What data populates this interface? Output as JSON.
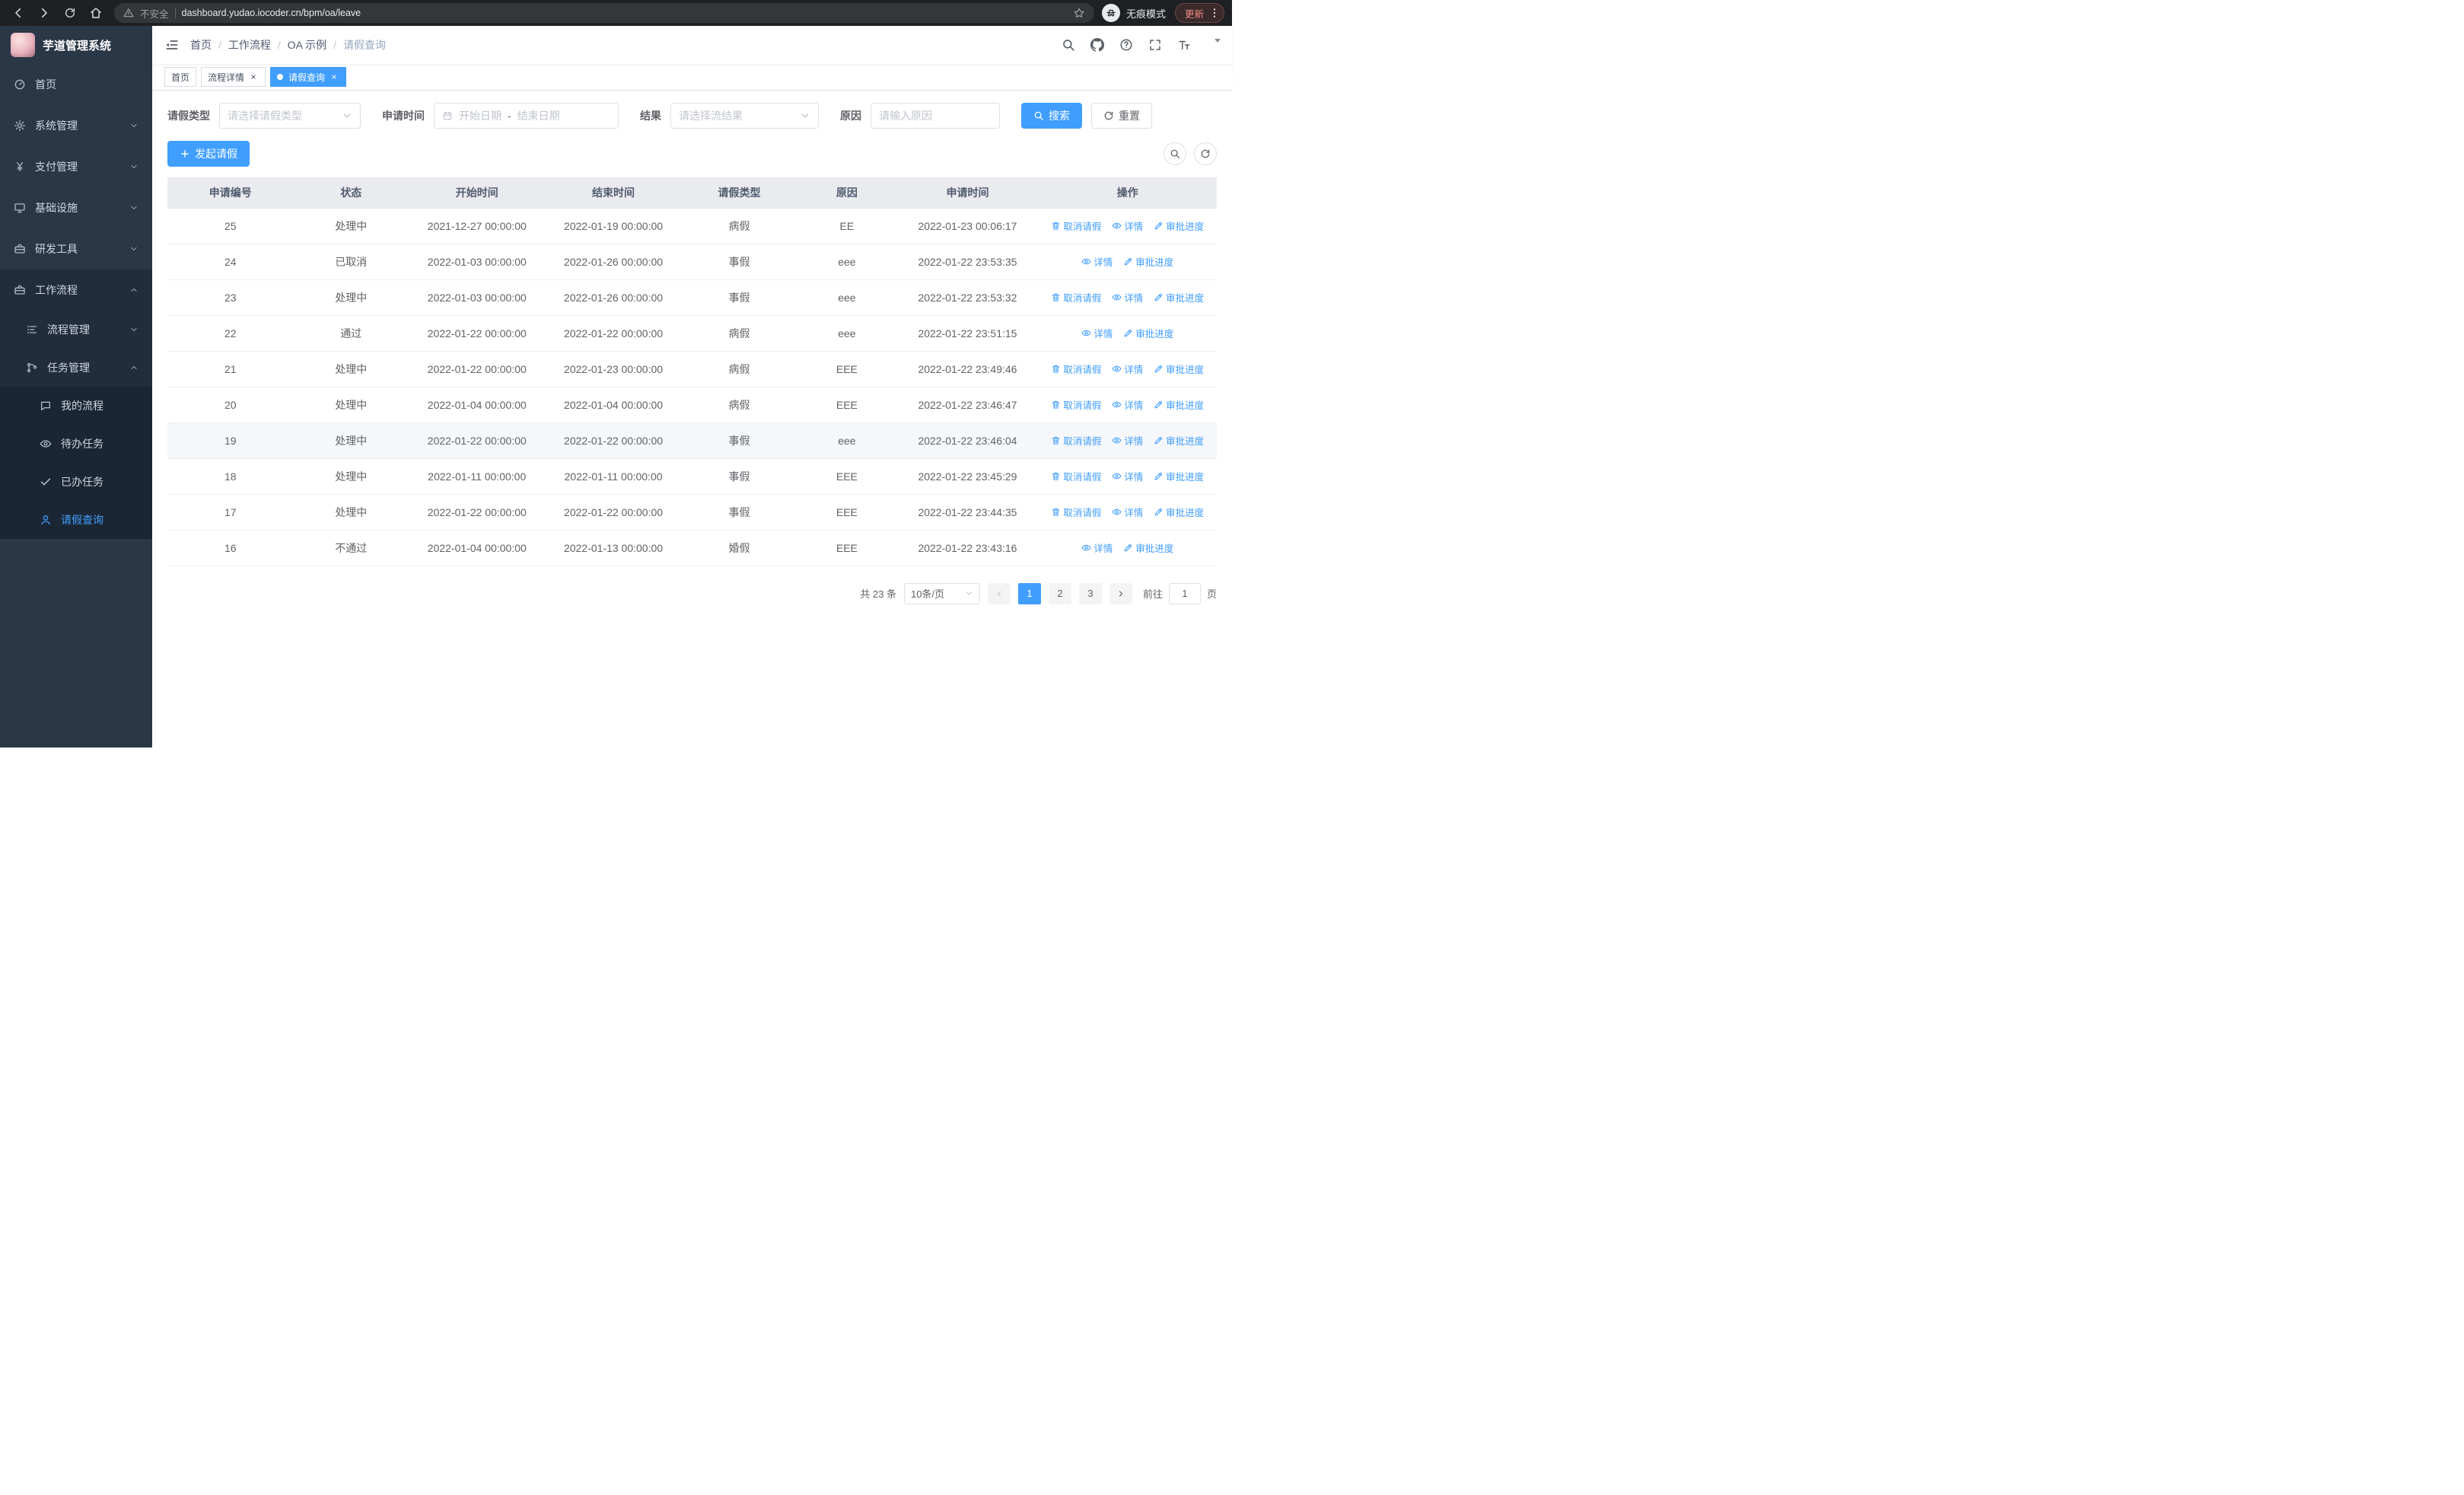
{
  "browser": {
    "security_label": "不安全",
    "url": "dashboard.yudao.iocoder.cn/bpm/oa/leave",
    "incognito_label": "无痕模式",
    "update_label": "更新"
  },
  "sidebar": {
    "logo_title": "芋道管理系统",
    "items": [
      {
        "label": "首页"
      },
      {
        "label": "系统管理"
      },
      {
        "label": "支付管理"
      },
      {
        "label": "基础设施"
      },
      {
        "label": "研发工具"
      },
      {
        "label": "工作流程"
      }
    ],
    "workflow_children": [
      {
        "label": "流程管理"
      },
      {
        "label": "任务管理"
      }
    ],
    "task_children": [
      {
        "label": "我的流程"
      },
      {
        "label": "待办任务"
      },
      {
        "label": "已办任务"
      },
      {
        "label": "请假查询"
      }
    ]
  },
  "header": {
    "breadcrumb": [
      "首页",
      "工作流程",
      "OA 示例",
      "请假查询"
    ],
    "separator": "/"
  },
  "tabs": [
    {
      "label": "首页"
    },
    {
      "label": "流程详情"
    },
    {
      "label": "请假查询"
    }
  ],
  "filters": {
    "leave_type_label": "请假类型",
    "leave_type_placeholder": "请选择请假类型",
    "apply_time_label": "申请时间",
    "start_date_placeholder": "开始日期",
    "date_separator": "-",
    "end_date_placeholder": "结束日期",
    "result_label": "结果",
    "result_placeholder": "请选择流结果",
    "reason_label": "原因",
    "reason_placeholder": "请输入原因",
    "search_label": "搜索",
    "reset_label": "重置"
  },
  "toolbar": {
    "create_label": "发起请假"
  },
  "table": {
    "headers": [
      "申请编号",
      "状态",
      "开始时间",
      "结束时间",
      "请假类型",
      "原因",
      "申请时间",
      "操作"
    ],
    "actions": {
      "cancel": "取消请假",
      "detail": "详情",
      "progress": "审批进度"
    },
    "rows": [
      {
        "id": "25",
        "status": "处理中",
        "start": "2021-12-27 00:00:00",
        "end": "2022-01-19 00:00:00",
        "type": "病假",
        "reason": "EE",
        "applied": "2022-01-23 00:06:17",
        "can_cancel": true,
        "highlight": false
      },
      {
        "id": "24",
        "status": "已取消",
        "start": "2022-01-03 00:00:00",
        "end": "2022-01-26 00:00:00",
        "type": "事假",
        "reason": "eee",
        "applied": "2022-01-22 23:53:35",
        "can_cancel": false,
        "highlight": false
      },
      {
        "id": "23",
        "status": "处理中",
        "start": "2022-01-03 00:00:00",
        "end": "2022-01-26 00:00:00",
        "type": "事假",
        "reason": "eee",
        "applied": "2022-01-22 23:53:32",
        "can_cancel": true,
        "highlight": false
      },
      {
        "id": "22",
        "status": "通过",
        "start": "2022-01-22 00:00:00",
        "end": "2022-01-22 00:00:00",
        "type": "病假",
        "reason": "eee",
        "applied": "2022-01-22 23:51:15",
        "can_cancel": false,
        "highlight": false
      },
      {
        "id": "21",
        "status": "处理中",
        "start": "2022-01-22 00:00:00",
        "end": "2022-01-23 00:00:00",
        "type": "病假",
        "reason": "EEE",
        "applied": "2022-01-22 23:49:46",
        "can_cancel": true,
        "highlight": false
      },
      {
        "id": "20",
        "status": "处理中",
        "start": "2022-01-04 00:00:00",
        "end": "2022-01-04 00:00:00",
        "type": "病假",
        "reason": "EEE",
        "applied": "2022-01-22 23:46:47",
        "can_cancel": true,
        "highlight": false
      },
      {
        "id": "19",
        "status": "处理中",
        "start": "2022-01-22 00:00:00",
        "end": "2022-01-22 00:00:00",
        "type": "事假",
        "reason": "eee",
        "applied": "2022-01-22 23:46:04",
        "can_cancel": true,
        "highlight": true
      },
      {
        "id": "18",
        "status": "处理中",
        "start": "2022-01-11 00:00:00",
        "end": "2022-01-11 00:00:00",
        "type": "事假",
        "reason": "EEE",
        "applied": "2022-01-22 23:45:29",
        "can_cancel": true,
        "highlight": false
      },
      {
        "id": "17",
        "status": "处理中",
        "start": "2022-01-22 00:00:00",
        "end": "2022-01-22 00:00:00",
        "type": "事假",
        "reason": "EEE",
        "applied": "2022-01-22 23:44:35",
        "can_cancel": true,
        "highlight": false
      },
      {
        "id": "16",
        "status": "不通过",
        "start": "2022-01-04 00:00:00",
        "end": "2022-01-13 00:00:00",
        "type": "婚假",
        "reason": "EEE",
        "applied": "2022-01-22 23:43:16",
        "can_cancel": false,
        "highlight": false
      }
    ]
  },
  "pagination": {
    "total_text": "共 23 条",
    "page_size_text": "10条/页",
    "pages": [
      "1",
      "2",
      "3"
    ],
    "active_page": "1",
    "goto_label": "前往",
    "goto_value": "1",
    "page_unit": "页"
  },
  "colors": {
    "primary": "#409eff",
    "sidebar_bg": "#2a3747",
    "table_header_bg": "#e9ebef"
  },
  "icons": [
    "back-icon",
    "forward-icon",
    "reload-icon",
    "home-icon",
    "warning-icon",
    "star-icon",
    "incognito-icon",
    "kebab-menu-icon",
    "dashboard-icon",
    "gear-icon",
    "yen-icon",
    "monitor-icon",
    "toolbox-icon",
    "workflow-icon",
    "list-tree-icon",
    "branch-icon",
    "chat-icon",
    "eye-icon",
    "check-icon",
    "user-icon",
    "collapse-sidebar-icon",
    "search-icon",
    "github-icon",
    "help-icon",
    "fullscreen-icon",
    "font-size-icon",
    "chevron-down-icon",
    "calendar-icon",
    "refresh-icon",
    "plus-icon",
    "trash-icon",
    "edit-icon"
  ]
}
